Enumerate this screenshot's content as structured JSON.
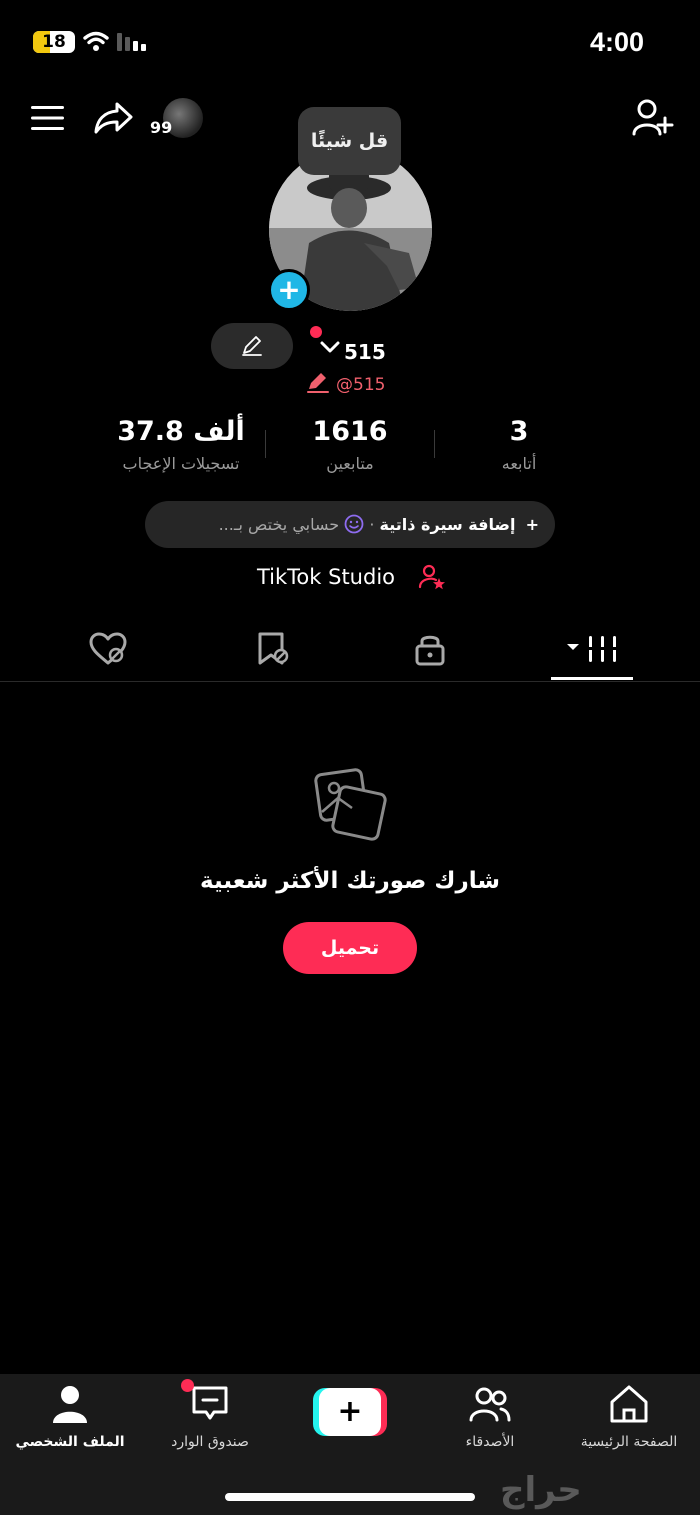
{
  "status_bar": {
    "battery": "18",
    "battery_level": 0.18,
    "time": "4:00"
  },
  "top_bar": {
    "notification_count": "99",
    "compose_bubble": "قل شيئًا"
  },
  "profile": {
    "nickname": "515",
    "username": "@515",
    "stats": [
      {
        "value": "3",
        "label": "أتابعه"
      },
      {
        "value": "1616",
        "label": "متابعين"
      },
      {
        "value": "37.8 ألف",
        "label": "تسجيلات الإعجاب"
      }
    ],
    "bio": {
      "add_prefix": "+",
      "add_label": "إضافة سيرة ذاتية",
      "separator": "·",
      "suggestion": "حسابي يختص بـ..."
    },
    "studio_label": "TikTok Studio"
  },
  "tabs": [
    {
      "id": "videos",
      "icon": "grid-icon",
      "active": true
    },
    {
      "id": "private",
      "icon": "lock-icon"
    },
    {
      "id": "favorites",
      "icon": "bookmark-hidden-icon"
    },
    {
      "id": "liked",
      "icon": "heart-hidden-icon"
    }
  ],
  "empty_state": {
    "title": "شارك صورتك الأكثر شعبية",
    "button": "تحميل"
  },
  "bottom_nav": [
    {
      "id": "home",
      "label": "الصفحة الرئيسية",
      "icon": "home-icon"
    },
    {
      "id": "friends",
      "label": "الأصدقاء",
      "icon": "friends-icon"
    },
    {
      "id": "create",
      "label": "+",
      "icon": "create-icon"
    },
    {
      "id": "inbox",
      "label": "صندوق الوارد",
      "icon": "inbox-icon"
    },
    {
      "id": "profile",
      "label": "الملف الشخصي",
      "icon": "person-icon",
      "active": true
    }
  ],
  "watermark": "حراج",
  "colors": {
    "accent": "#fe2c55",
    "cyan": "#25f4ee",
    "add_button": "#20b7e6",
    "battery": "#f2c80f"
  }
}
